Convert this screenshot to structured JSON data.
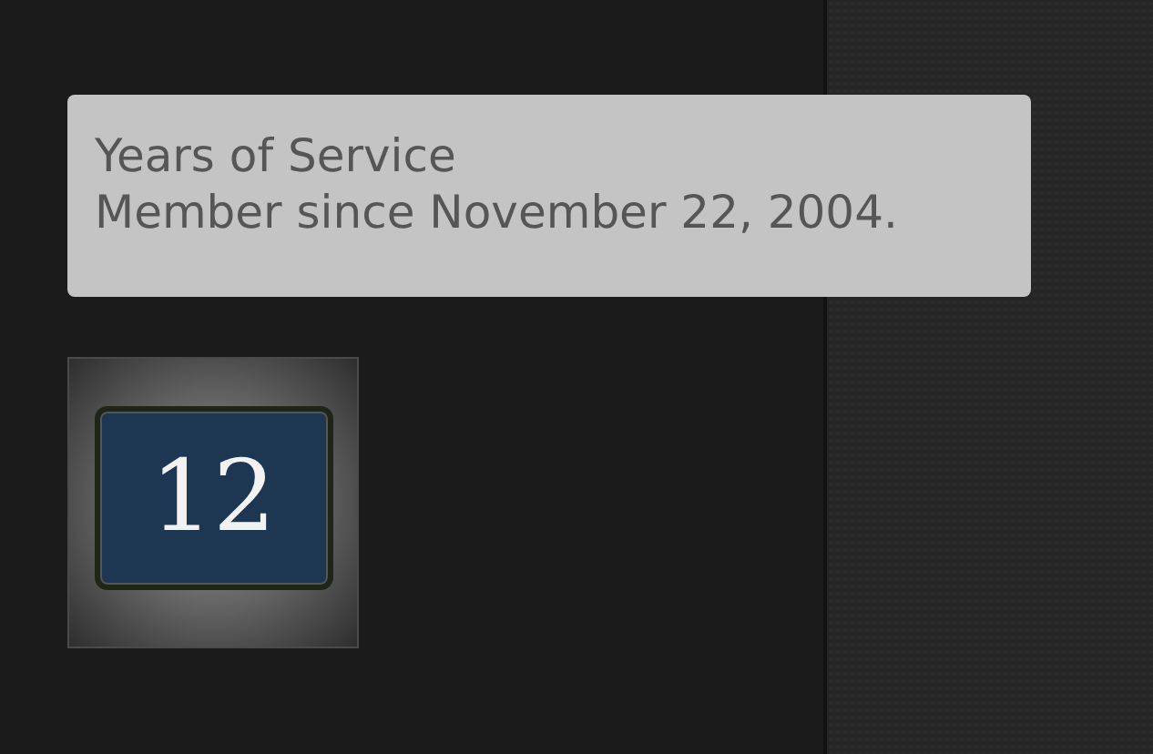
{
  "tooltip": {
    "title": "Years of Service",
    "text": "Member since November 22, 2004."
  },
  "badge": {
    "value": "12"
  }
}
